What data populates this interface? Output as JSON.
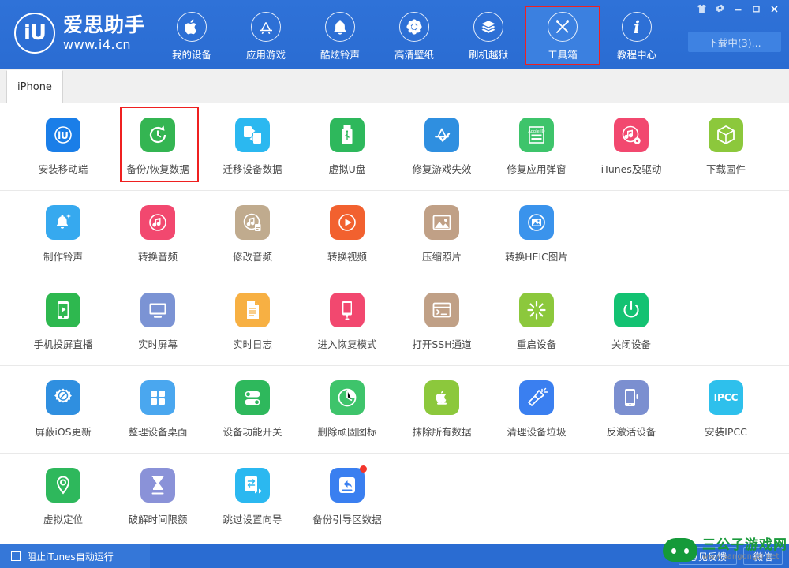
{
  "app": {
    "brand_name": "爱思助手",
    "brand_url": "www.i4.cn",
    "brand_mark": "iU"
  },
  "header": {
    "nav": [
      {
        "label": "我的设备",
        "icon": "apple-icon",
        "active": false,
        "highlight": false
      },
      {
        "label": "应用游戏",
        "icon": "appstore-icon",
        "active": false,
        "highlight": false
      },
      {
        "label": "酷炫铃声",
        "icon": "bell-icon",
        "active": false,
        "highlight": false
      },
      {
        "label": "高清壁纸",
        "icon": "flower-icon",
        "active": false,
        "highlight": false
      },
      {
        "label": "刷机越狱",
        "icon": "flash-box-icon",
        "active": false,
        "highlight": false
      },
      {
        "label": "工具箱",
        "icon": "tools-icon",
        "active": true,
        "highlight": true
      },
      {
        "label": "教程中心",
        "icon": "info-icon",
        "active": false,
        "highlight": false
      }
    ],
    "window_controls": [
      {
        "name": "shirt-icon",
        "glyph": "shirt"
      },
      {
        "name": "gear-icon",
        "glyph": "gear"
      },
      {
        "name": "minimize-icon",
        "glyph": "minimize"
      },
      {
        "name": "maximize-icon",
        "glyph": "maximize"
      },
      {
        "name": "close-icon",
        "glyph": "close"
      }
    ],
    "download_button": "下载中(3)..."
  },
  "tabs": {
    "items": [
      {
        "label": "iPhone",
        "active": true
      }
    ]
  },
  "tools": {
    "rows": [
      [
        {
          "label": "安装移动端",
          "icon": "i4-app-icon",
          "color": "#1a7ee8",
          "highlight": false,
          "badge": false
        },
        {
          "label": "备份/恢复数据",
          "icon": "backup-restore-icon",
          "color": "#34b552",
          "highlight": true,
          "badge": false
        },
        {
          "label": "迁移设备数据",
          "icon": "migrate-device-icon",
          "color": "#2bb8f0",
          "highlight": false,
          "badge": false
        },
        {
          "label": "虚拟U盘",
          "icon": "usb-drive-icon",
          "color": "#2eb85c",
          "highlight": false,
          "badge": false
        },
        {
          "label": "修复游戏失效",
          "icon": "appstore-fix-icon",
          "color": "#2f8fe0",
          "highlight": false,
          "badge": false
        },
        {
          "label": "修复应用弹窗",
          "icon": "apple-id-icon",
          "color": "#3ec46b",
          "highlight": false,
          "badge": false
        },
        {
          "label": "iTunes及驱动",
          "icon": "itunes-driver-icon",
          "color": "#f2486f",
          "highlight": false,
          "badge": false
        },
        {
          "label": "下载固件",
          "icon": "firmware-box-icon",
          "color": "#8cc83c",
          "highlight": false,
          "badge": false
        }
      ],
      [
        {
          "label": "制作铃声",
          "icon": "ringtone-maker-icon",
          "color": "#36a9ef",
          "highlight": false,
          "badge": false
        },
        {
          "label": "转换音频",
          "icon": "audio-convert-icon",
          "color": "#f2486f",
          "highlight": false,
          "badge": false
        },
        {
          "label": "修改音频",
          "icon": "audio-edit-icon",
          "color": "#c0ab8e",
          "highlight": false,
          "badge": false
        },
        {
          "label": "转换视频",
          "icon": "video-convert-icon",
          "color": "#f2612f",
          "highlight": false,
          "badge": false
        },
        {
          "label": "压缩照片",
          "icon": "photo-compress-icon",
          "color": "#c0a086",
          "highlight": false,
          "badge": false
        },
        {
          "label": "转换HEIC图片",
          "icon": "heic-convert-icon",
          "color": "#3a93ec",
          "highlight": false,
          "badge": false
        }
      ],
      [
        {
          "label": "手机投屏直播",
          "icon": "screen-cast-icon",
          "color": "#2eb84f",
          "highlight": false,
          "badge": false
        },
        {
          "label": "实时屏幕",
          "icon": "realtime-screen-icon",
          "color": "#7b93d4",
          "highlight": false,
          "badge": false
        },
        {
          "label": "实时日志",
          "icon": "realtime-log-icon",
          "color": "#f7b043",
          "highlight": false,
          "badge": false
        },
        {
          "label": "进入恢复模式",
          "icon": "recovery-mode-icon",
          "color": "#f2486f",
          "highlight": false,
          "badge": false
        },
        {
          "label": "打开SSH通道",
          "icon": "ssh-tunnel-icon",
          "color": "#c0a086",
          "highlight": false,
          "badge": false
        },
        {
          "label": "重启设备",
          "icon": "reboot-device-icon",
          "color": "#8cc83c",
          "highlight": false,
          "badge": false
        },
        {
          "label": "关闭设备",
          "icon": "power-off-icon",
          "color": "#13c272",
          "highlight": false,
          "badge": false
        }
      ],
      [
        {
          "label": "屏蔽iOS更新",
          "icon": "block-ios-update-icon",
          "color": "#2f8fe0",
          "highlight": false,
          "badge": false
        },
        {
          "label": "整理设备桌面",
          "icon": "organize-desktop-icon",
          "color": "#4aa7ef",
          "highlight": false,
          "badge": false
        },
        {
          "label": "设备功能开关",
          "icon": "feature-toggle-icon",
          "color": "#2eb85c",
          "highlight": false,
          "badge": false
        },
        {
          "label": "删除顽固图标",
          "icon": "remove-icon-icon",
          "color": "#3ec46b",
          "highlight": false,
          "badge": false
        },
        {
          "label": "抹除所有数据",
          "icon": "erase-all-icon",
          "color": "#8cc83c",
          "highlight": false,
          "badge": false
        },
        {
          "label": "清理设备垃圾",
          "icon": "clean-junk-icon",
          "color": "#3a7ff0",
          "highlight": false,
          "badge": false
        },
        {
          "label": "反激活设备",
          "icon": "deactivate-device-icon",
          "color": "#7b8fd0",
          "highlight": false,
          "badge": false
        },
        {
          "label": "安装IPCC",
          "icon": "ipcc-install-icon",
          "color": "#2ec0ec",
          "highlight": false,
          "badge": false,
          "text": "IPCC"
        }
      ],
      [
        {
          "label": "虚拟定位",
          "icon": "virtual-location-icon",
          "color": "#2eb85c",
          "highlight": false,
          "badge": false
        },
        {
          "label": "破解时间限额",
          "icon": "time-limit-icon",
          "color": "#8a92d8",
          "highlight": false,
          "badge": false
        },
        {
          "label": "跳过设置向导",
          "icon": "skip-setup-icon",
          "color": "#2bb8f0",
          "highlight": false,
          "badge": false
        },
        {
          "label": "备份引导区数据",
          "icon": "backup-boot-icon",
          "color": "#3a7ff0",
          "highlight": false,
          "badge": true
        }
      ]
    ]
  },
  "footer": {
    "checkbox_label": "阻止iTunes自动运行",
    "checkbox_checked": false,
    "buttons": [
      {
        "label": "意见反馈"
      },
      {
        "label": "微信"
      }
    ]
  },
  "watermark": {
    "title": "三公子游戏网",
    "url": "www.sangongzi.net"
  },
  "colors": {
    "header_blue": "#2a6cd2",
    "highlight_red": "#ef2020",
    "active_nav": "#3b80e0"
  }
}
